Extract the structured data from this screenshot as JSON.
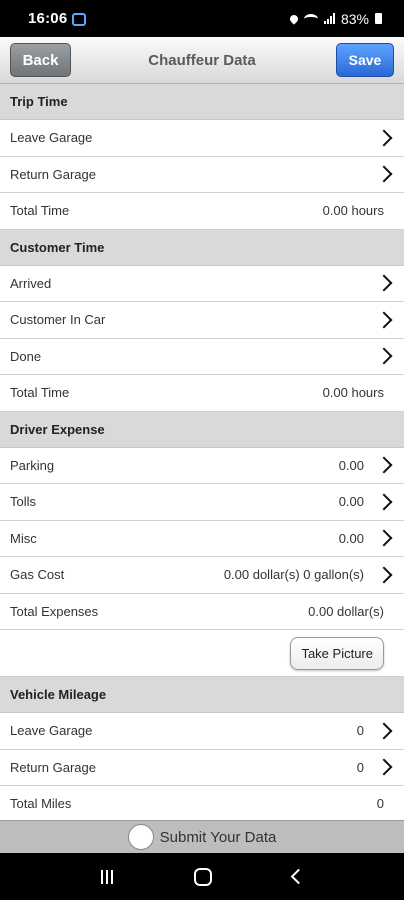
{
  "status_bar": {
    "time": "16:06",
    "battery": "83%"
  },
  "header": {
    "title": "Chauffeur Data",
    "back_label": "Back",
    "save_label": "Save"
  },
  "trip_time": {
    "title": "Trip Time",
    "leave_garage": "Leave Garage",
    "return_garage": "Return Garage",
    "total_label": "Total Time",
    "total_value": "0.00 hours"
  },
  "customer_time": {
    "title": "Customer Time",
    "arrived": "Arrived",
    "customer_in_car": "Customer In Car",
    "done": "Done",
    "total_label": "Total Time",
    "total_value": "0.00 hours"
  },
  "driver_expense": {
    "title": "Driver Expense",
    "parking_label": "Parking",
    "parking_value": "0.00",
    "tolls_label": "Tolls",
    "tolls_value": "0.00",
    "misc_label": "Misc",
    "misc_value": "0.00",
    "gas_label": "Gas Cost",
    "gas_value": "0.00 dollar(s) 0 gallon(s)",
    "total_label": "Total Expenses",
    "total_value": "0.00 dollar(s)",
    "take_picture_label": "Take Picture"
  },
  "vehicle_mileage": {
    "title": "Vehicle Mileage",
    "leave_label": "Leave Garage",
    "leave_value": "0",
    "return_label": "Return Garage",
    "return_value": "0",
    "total_label": "Total Miles",
    "total_value": "0"
  },
  "submit": {
    "label": "Submit Your Data"
  },
  "colors": {
    "header_bg": "#d9d9d9",
    "save_button": "#2a69d6",
    "back_button": "#6f7478",
    "submit_bar": "#bdbdbd"
  }
}
